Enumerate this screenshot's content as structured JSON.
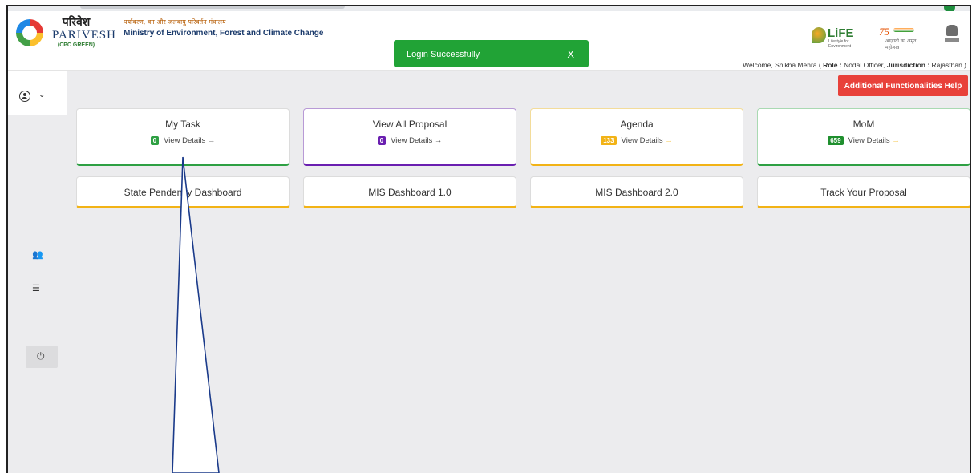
{
  "header": {
    "brand_hindi": "परिवेश",
    "brand_name": "PARIVESH",
    "brand_sub": "(CPC GREEN)",
    "ministry_hindi": "पर्यावरण, वन और जलवायु परिवर्तन मंत्रालय",
    "ministry_en": "Ministry of Environment, Forest and Climate Change",
    "life_logo_text": "LiFE",
    "life_logo_sub": "Lifestyle for Environment",
    "azadi_text": "75",
    "azadi_sub": "आज़ादी का अमृत महोत्सव"
  },
  "toast": {
    "message": "Login Successfully",
    "close": "X",
    "color": "#21a336"
  },
  "welcome": {
    "prefix": "Welcome, Shikha Mehra ( ",
    "role_label": "Role :",
    "role_value": " Nodal Officer, ",
    "jurisdiction_label": "Jurisdiction :",
    "jurisdiction_value": " Rajasthan )"
  },
  "sidebar": {
    "user_icon": "user-circle-icon",
    "chevron": "⌄",
    "items": [
      {
        "icon": "users-icon",
        "glyph": "👥"
      },
      {
        "icon": "list-icon",
        "glyph": "☰"
      },
      {
        "icon": "power-icon",
        "glyph": "⏻"
      }
    ]
  },
  "main": {
    "help_button": "Additional Functionalities Help",
    "help_color": "#e8413a",
    "cards": [
      {
        "title": "My Task",
        "count": "0",
        "link": "View Details →",
        "accent": "#2ea043"
      },
      {
        "title": "View All Proposal",
        "count": "0",
        "link": "View Details →",
        "accent": "#6a1fb0"
      },
      {
        "title": "Agenda",
        "count": "133",
        "link": "View Details",
        "arrow": "→",
        "accent": "#f2b316"
      },
      {
        "title": "MoM",
        "count": "659",
        "link": "View Details",
        "arrow": "→",
        "accent": "#2ea043",
        "badge": "#1f8f2e"
      }
    ],
    "dashboards": [
      {
        "title": "State Pendency Dashboard"
      },
      {
        "title": "MIS Dashboard 1.0"
      },
      {
        "title": "MIS Dashboard 2.0"
      },
      {
        "title": "Track Your Proposal"
      }
    ],
    "dashboard_accent": "#f2b316"
  }
}
